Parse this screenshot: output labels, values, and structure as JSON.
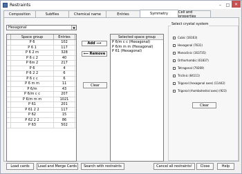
{
  "window": {
    "title": "Restraints",
    "min_glyph": "–",
    "max_glyph": "□",
    "close_glyph": "✕"
  },
  "tabs": [
    "Composition",
    "Subfiles",
    "Chemical name",
    "Entries",
    "Symmetry",
    "Cell and properties"
  ],
  "active_tab": "Symmetry",
  "crystal_system_select": {
    "value": "Hexagonal",
    "arrow": "▼"
  },
  "space_group_table": {
    "headers": [
      "Space group",
      "Entries"
    ],
    "rows": [
      {
        "group": "P 6",
        "entries": "102"
      },
      {
        "group": "P 6 1",
        "entries": "117"
      },
      {
        "group": "P 6 2 m",
        "entries": "328"
      },
      {
        "group": "P 6 c 2",
        "entries": "40"
      },
      {
        "group": "P 6m 2",
        "entries": "217"
      },
      {
        "group": "P 6",
        "entries": "4"
      },
      {
        "group": "P 6 2 2",
        "entries": "6"
      },
      {
        "group": "P 6 c c",
        "entries": "6"
      },
      {
        "group": "P 6 m m",
        "entries": "11"
      },
      {
        "group": "P 6/m",
        "entries": "43"
      },
      {
        "group": "P 6/m c c",
        "entries": "207"
      },
      {
        "group": "P 6/m m m",
        "entries": "1021"
      },
      {
        "group": "P 61",
        "entries": "201"
      },
      {
        "group": "P 61 2 2",
        "entries": "117"
      },
      {
        "group": "P 62",
        "entries": "15"
      },
      {
        "group": "P 62 2 2",
        "entries": "86"
      },
      {
        "group": "P 63",
        "entries": "502"
      }
    ]
  },
  "buttons": {
    "add": "Add ⟶",
    "remove": "⟵ Remove",
    "clear_left": "Clear",
    "clear_right": "Clear",
    "load_cards": "Load cards",
    "load_merge": "Load and Merge Cards",
    "search": "Search with restraints",
    "cancel_all": "Cancel all restraints!",
    "close": "Close",
    "help": "Help"
  },
  "selected_space_group": {
    "header": "Selected space group",
    "items": [
      "P 6/m c c (Hexagonal)",
      "P 6/m m m (Hexagonal)",
      "P 61 (Hexagonal)"
    ]
  },
  "crystal_system": {
    "title": "Select crystal system",
    "options": [
      "Cubic (16163)",
      "Hexagonal (7631)",
      "Monoclinic (163735)",
      "Orthorhombic (61837)",
      "Tetragonal (79269)",
      "Triclinic (84111)",
      "Trigonal (hexagonal axes) (11442)",
      "Trigonal (rhombohedral axes) (923)"
    ]
  }
}
